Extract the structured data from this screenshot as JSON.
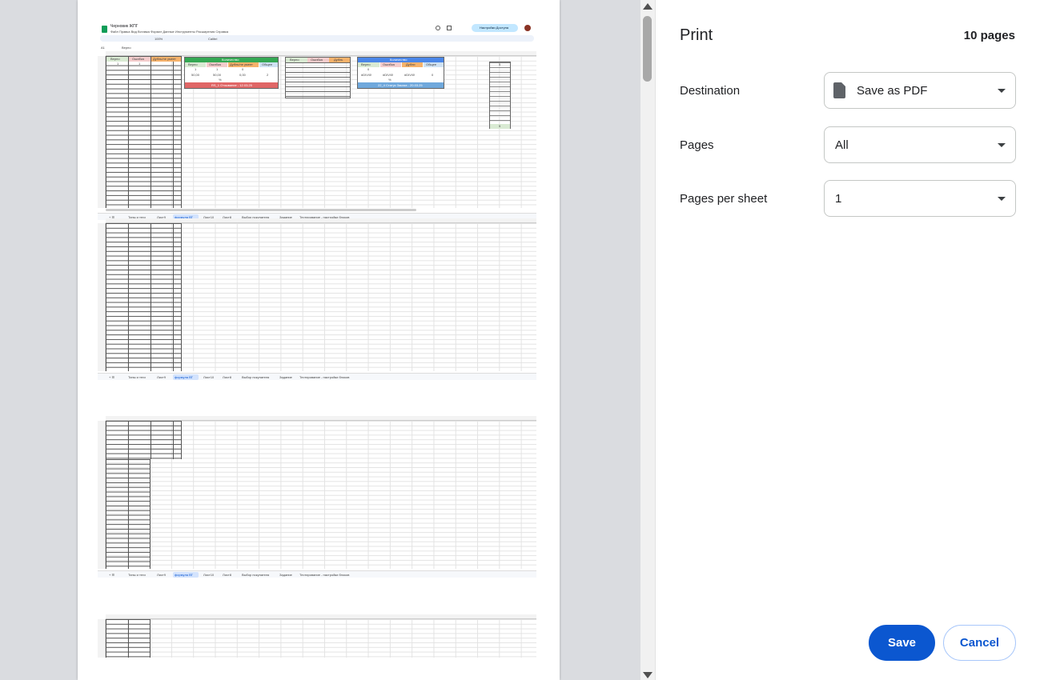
{
  "panel": {
    "title": "Print",
    "page_count": "10 pages",
    "destination_label": "Destination",
    "destination_value": "Save as PDF",
    "pages_label": "Pages",
    "pages_value": "All",
    "pages_per_sheet_label": "Pages per sheet",
    "pages_per_sheet_value": "1",
    "save_label": "Save",
    "cancel_label": "Cancel"
  },
  "preview": {
    "doc_title": "Черновик ЖПГ",
    "menu": [
      "Файл",
      "Правка",
      "Вид",
      "Вставка",
      "Формат",
      "Данные",
      "Инструменты",
      "Расширения",
      "Справка"
    ],
    "share_label": "Настройки Доступа",
    "font": "Calibri",
    "zoom": "100%",
    "formula_cell": "A1",
    "formula_value": "Верно",
    "table1_headers": [
      "Верно",
      "Ошибка",
      "Дубль/не умеет"
    ],
    "table1_values": [
      "1",
      "1"
    ],
    "table2_title": "Количество",
    "table2_headers": [
      "Верно",
      "Ошибка",
      "Дубль/не умеет",
      "Общее"
    ],
    "table2_row1": [
      "1",
      "1",
      "0"
    ],
    "table2_row2": [
      "50,00",
      "50,00",
      "0,00",
      "2"
    ],
    "table2_pct": "%",
    "table2_footer": "RS_1 Отзывание - 12.03.25",
    "table3_headers": [
      "Верно",
      "Ошибка",
      "Дубль"
    ],
    "table4_title": "Количество",
    "table4_headers": [
      "Верно",
      "Ошибка",
      "Дубли",
      "Общее"
    ],
    "table4_row1": [
      "0"
    ],
    "table4_row2": [
      "#DIV/0!",
      "#DIV/0!",
      "#DIV/0!",
      "0"
    ],
    "table4_pct": "%",
    "table4_footer": "22_4 Статус Заказа - 20.03.25",
    "right_col_top": "5",
    "right_col_bottom": "5",
    "tabs": [
      "Типы и теги",
      "Лист9",
      "формула ВТ",
      "Лист10",
      "Лист8",
      "Выбор покупателя",
      "Задание",
      "Тестирование - настройки блоков"
    ],
    "columns": [
      "A",
      "B",
      "C",
      "D",
      "E",
      "F",
      "G",
      "H",
      "I",
      "J",
      "K",
      "L",
      "M",
      "N",
      "O",
      "P",
      "Q",
      "R",
      "S",
      "T",
      "U"
    ],
    "colors": {
      "green_header": "#34a853",
      "blue_header": "#4a86e8",
      "red_footer": "#e06666",
      "blue_footer": "#6fa8dc",
      "light_green": "#d9ead3",
      "light_red": "#f4cccc",
      "orange": "#f6b26b",
      "light_blue": "#cfe2f3"
    }
  }
}
